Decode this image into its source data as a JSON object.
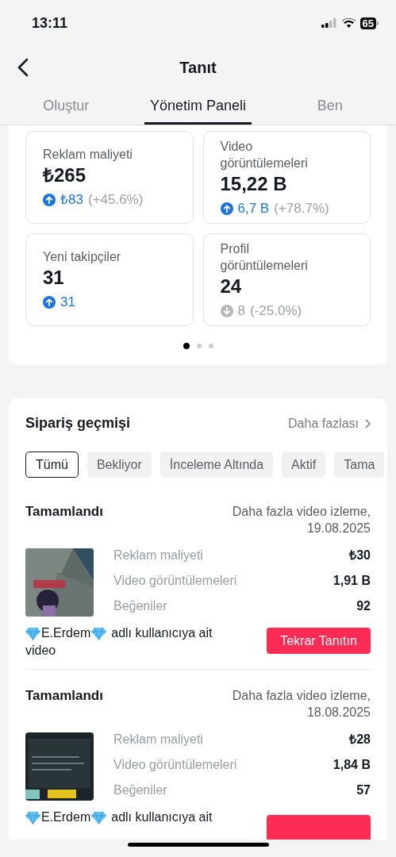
{
  "status_bar": {
    "time": "13:11",
    "battery": "65"
  },
  "header": {
    "title": "Tanıt"
  },
  "tabs": [
    {
      "label": "Oluştur",
      "selected": false
    },
    {
      "label": "Yönetim Paneli",
      "selected": true
    },
    {
      "label": "Ben",
      "selected": false
    }
  ],
  "stats": [
    {
      "label": "Reklam maliyeti",
      "value": "₺265",
      "kind": "up",
      "delta": "₺83",
      "percent": "(+45.6%)"
    },
    {
      "label": "Video görüntülemeleri",
      "value": "15,22 B",
      "kind": "up",
      "delta": "6,7 B",
      "percent": "(+78.7%)"
    },
    {
      "label": "Yeni takipçiler",
      "value": "31",
      "kind": "up",
      "delta": "31"
    },
    {
      "label": "Profil görüntülemeleri",
      "value": "24",
      "kind": "down",
      "delta": "8",
      "percent": "(-25.0%)"
    }
  ],
  "pager": [
    {
      "selected": true
    },
    {
      "selected": false
    },
    {
      "selected": false
    }
  ],
  "orders_section": {
    "title": "Sipariş geçmişi",
    "more": "Daha fazlası",
    "filters": [
      {
        "label": "Tümü",
        "selected": true
      },
      {
        "label": "Bekliyor",
        "selected": false
      },
      {
        "label": "İnceleme Altında",
        "selected": false
      },
      {
        "label": "Aktif",
        "selected": false
      },
      {
        "label": "Tama",
        "selected": false
      }
    ],
    "orders": [
      {
        "status": "Tamamlandı",
        "goal": "Daha fazla video izleme,",
        "date": "19.08.2025",
        "metrics": [
          {
            "label": "Reklam maliyeti",
            "value": "₺30"
          },
          {
            "label": "Video görüntülemeleri",
            "value": "1,91 B"
          },
          {
            "label": "Beğeniler",
            "value": "92"
          }
        ],
        "owner": "E.Erdem",
        "owner_suffix": "adlı kullanıcıya ait",
        "owner_tail": "video",
        "button": "Tekrar Tanıtın"
      },
      {
        "status": "Tamamlandı",
        "goal": "Daha fazla video izleme,",
        "date": "18.08.2025",
        "metrics": [
          {
            "label": "Reklam maliyeti",
            "value": "₺28"
          },
          {
            "label": "Video görüntülemeleri",
            "value": "1,84 B"
          },
          {
            "label": "Beğeniler",
            "value": "57"
          }
        ],
        "owner": "E.Erdem",
        "owner_suffix": "adlı kullanıcıya ait",
        "button_cut": true
      }
    ]
  }
}
